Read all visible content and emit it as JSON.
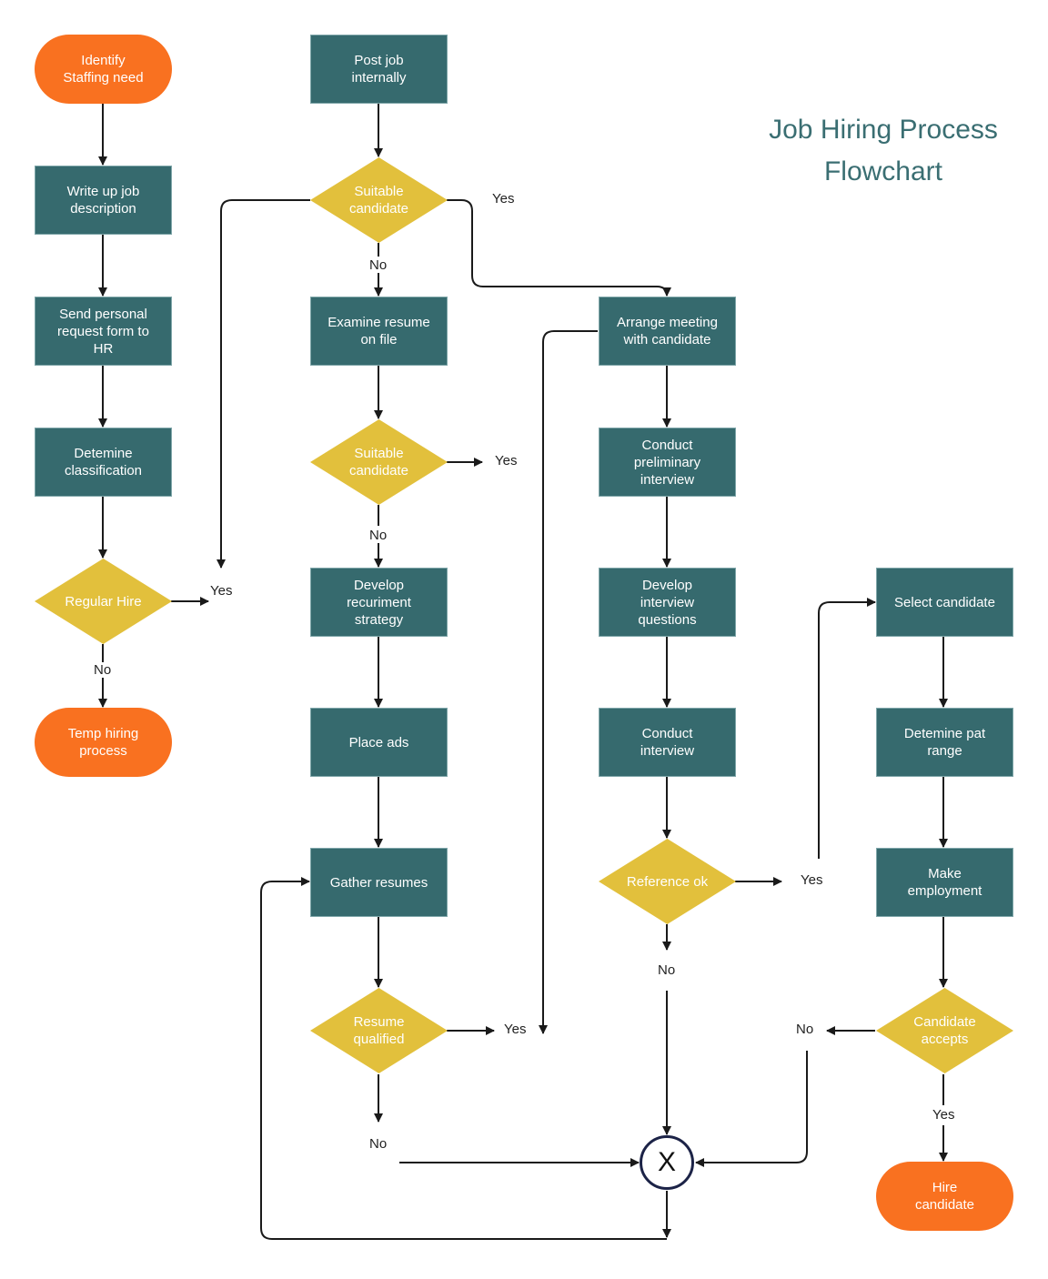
{
  "title": "Job Hiring Process\nFlowchart",
  "colors": {
    "process": "#366a6e",
    "terminal": "#f97120",
    "decision": "#e2c03c",
    "title": "#3a6e72",
    "connector": "#1a1a1a",
    "junction_border": "#1c2347"
  },
  "nodes": {
    "identify_need": "Identify\nStaffing need",
    "write_job_description": "Write up job\ndescription",
    "send_request_form": "Send personal\nrequest form to\nHR",
    "determine_classification": "Detemine\nclassification",
    "regular_hire": "Regular Hire",
    "temp_hiring": "Temp hiring\nprocess",
    "post_job_internally": "Post job\ninternally",
    "suitable_candidate_1": "Suitable\ncandidate",
    "examine_resume": "Examine resume\non file",
    "suitable_candidate_2": "Suitable\ncandidate",
    "develop_strategy": "Develop\nrecuriment\nstrategy",
    "place_ads": "Place ads",
    "gather_resumes": "Gather resumes",
    "resume_qualified": "Resume\nqualified",
    "arrange_meeting": "Arrange meeting\nwith candidate",
    "conduct_preliminary": "Conduct\npreliminary\ninterview",
    "develop_questions": "Develop\ninterview\nquestions",
    "conduct_interview": "Conduct\ninterview",
    "reference_ok": "Reference ok",
    "select_candidate": "Select candidate",
    "determine_pay_range": "Detemine pat\nrange",
    "make_employment": "Make\nemployment",
    "candidate_accepts": "Candidate\naccepts",
    "hire_candidate": "Hire\ncandidate",
    "junction": "X"
  },
  "edge_labels": {
    "regular_hire_yes": "Yes",
    "regular_hire_no": "No",
    "suitable1_yes": "Yes",
    "suitable1_no": "No",
    "suitable2_yes": "Yes",
    "suitable2_no": "No",
    "resume_yes": "Yes",
    "resume_no": "No",
    "reference_yes": "Yes",
    "reference_no": "No",
    "accepts_no": "No",
    "accepts_yes": "Yes"
  }
}
